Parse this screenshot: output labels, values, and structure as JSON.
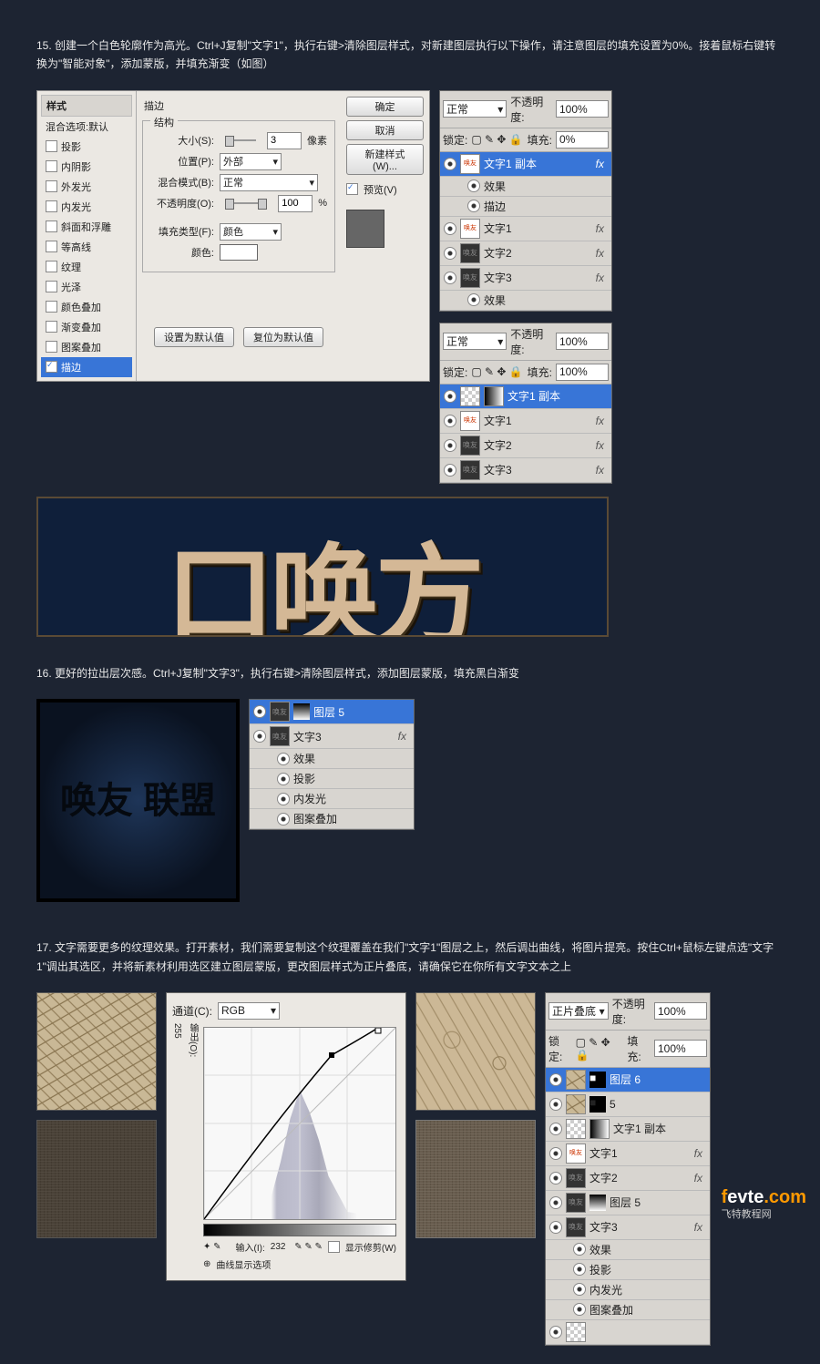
{
  "step15": "15. 创建一个白色轮廓作为高光。Ctrl+J复制\"文字1\"，执行右键>清除图层样式，对新建图层执行以下操作，请注意图层的填充设置为0%。接着鼠标右键转换为\"智能对象\"，添加蒙版，并填充渐变（如图）",
  "step16": "16. 更好的拉出层次感。Ctrl+J复制\"文字3\"，执行右键>清除图层样式，添加图层蒙版，填充黑白渐变",
  "step17": "17. 文字需要更多的纹理效果。打开素材，我们需要复制这个纹理覆盖在我们\"文字1\"图层之上，然后调出曲线，将图片提亮。按住Ctrl+鼠标左键点选\"文字1\"调出其选区，并将新素材利用选区建立图层蒙版，更改图层样式为正片叠底，请确保它在你所有文字文本之上",
  "ls": {
    "style": "样式",
    "blend": "混合选项:默认",
    "ds": "投影",
    "is": "内阴影",
    "og": "外发光",
    "ig": "内发光",
    "bv": "斜面和浮雕",
    "ct": "等高线",
    "tx": "纹理",
    "st": "光泽",
    "co": "颜色叠加",
    "go": "渐变叠加",
    "po": "图案叠加",
    "sk": "描边"
  },
  "stroke": {
    "title": "描边",
    "struct": "结构",
    "size": "大小(S):",
    "sizev": "3",
    "px": "像素",
    "pos": "位置(P):",
    "posv": "外部",
    "blend": "混合模式(B):",
    "blendv": "正常",
    "op": "不透明度(O):",
    "opv": "100",
    "pct": "%",
    "fill": "填充类型(F):",
    "fillv": "颜色",
    "color": "颜色:",
    "def1": "设置为默认值",
    "def2": "复位为默认值"
  },
  "btns": {
    "ok": "确定",
    "cancel": "取消",
    "new": "新建样式(W)...",
    "prev": "预览(V)"
  },
  "layers1": {
    "mode": "正常",
    "opacity": "不透明度:",
    "opv": "100%",
    "lock": "锁定:",
    "fill": "填充:",
    "fillv": "0%",
    "l1": "文字1 副本",
    "fx": "效果",
    "sk": "描边",
    "l2": "文字1",
    "l3": "文字2",
    "l4": "文字3",
    "fxl": "fx"
  },
  "layers2": {
    "fillv": "100%",
    "l1": "文字1 副本",
    "l2": "文字1",
    "l3": "文字2",
    "l4": "文字3"
  },
  "layers3": {
    "l1": "图层 5",
    "l2": "文字3",
    "fx": "效果",
    "ds": "投影",
    "ig": "内发光",
    "po": "图案叠加"
  },
  "curves": {
    "ch": "通道(C):",
    "rgb": "RGB",
    "out": "输出(O):",
    "outv": "255",
    "in": "输入(I):",
    "inv": "232",
    "show": "显示修剪(W)",
    "opt": "曲线显示选项"
  },
  "layers4": {
    "mode": "正片叠底",
    "l1": "图层 6",
    "l2": "5",
    "l3": "文字1 副本",
    "l4": "文字1",
    "l5": "文字2",
    "l6": "图层 5",
    "l7": "文字3",
    "fx": "效果",
    "ds": "投影",
    "ig": "内发光",
    "po": "图案叠加"
  },
  "art": "口唤方",
  "art2": "唤友\n联盟",
  "logo": {
    "t": "fevte.com",
    "s": "飞特教程网"
  }
}
